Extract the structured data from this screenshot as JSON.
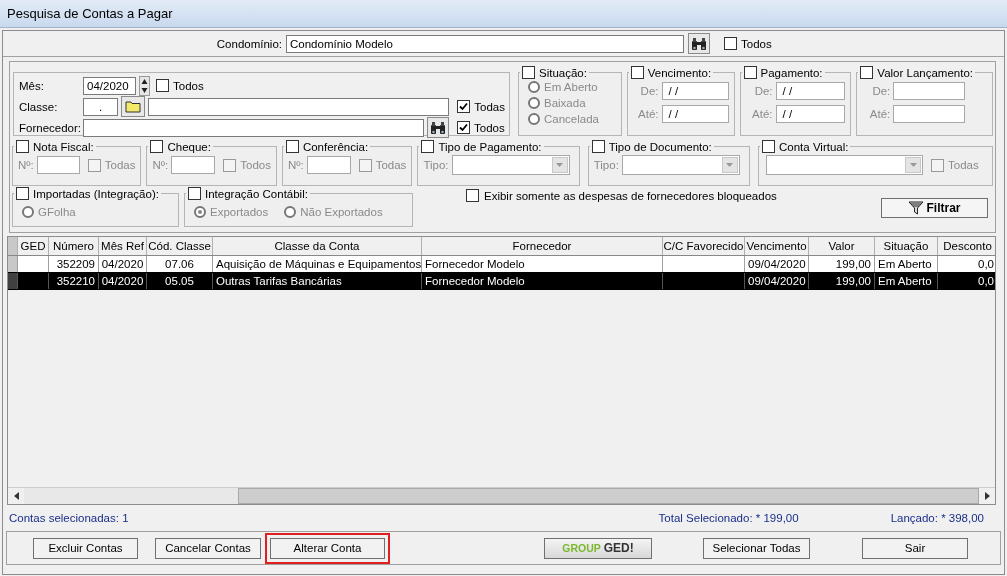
{
  "window": {
    "title": "Pesquisa de Contas a Pagar"
  },
  "condominio": {
    "label": "Condomínio:",
    "value": "Condomínio Modelo",
    "todos": {
      "label": "Todos",
      "checked": false
    }
  },
  "main_filters": {
    "mes": {
      "label": "Mês:",
      "value": "04/2020",
      "todos": {
        "label": "Todos",
        "checked": false
      }
    },
    "classe": {
      "label": "Classe:",
      "code": ".",
      "todas": {
        "label": "Todas",
        "checked": true
      }
    },
    "fornecedor": {
      "label": "Fornecedor:",
      "todos": {
        "label": "Todos",
        "checked": true
      }
    }
  },
  "filter_rows": [
    [
      {
        "kind": "radio_stack",
        "title": "Situação:",
        "checked": false,
        "disabled": true,
        "options": [
          {
            "label": "Em Aberto",
            "selected": false
          },
          {
            "label": "Baixada",
            "selected": false
          },
          {
            "label": "Cancelada",
            "selected": false
          }
        ]
      },
      {
        "kind": "range",
        "title": "Vencimento:",
        "checked": false,
        "disabled": true,
        "fields": [
          {
            "label": "De:",
            "value": "/ /"
          },
          {
            "label": "Até:",
            "value": "/ /"
          }
        ]
      },
      {
        "kind": "range",
        "title": "Pagamento:",
        "checked": false,
        "disabled": true,
        "fields": [
          {
            "label": "De:",
            "value": "/ /"
          },
          {
            "label": "Até:",
            "value": "/ /"
          }
        ]
      },
      {
        "kind": "range",
        "title": "Valor Lançamento:",
        "checked": false,
        "disabled": true,
        "fields": [
          {
            "label": "De:"
          },
          {
            "label": "Até:"
          }
        ]
      }
    ],
    [
      {
        "kind": "number",
        "title": "Nota Fiscal:",
        "checked": false,
        "disabled": true,
        "field_label": "Nº:",
        "option": {
          "label": "Todas",
          "checked": false
        }
      },
      {
        "kind": "number",
        "title": "Cheque:",
        "checked": false,
        "disabled": true,
        "field_label": "Nº:",
        "option": {
          "label": "Todos",
          "checked": false
        }
      },
      {
        "kind": "number",
        "title": "Conferência:",
        "checked": false,
        "disabled": true,
        "field_label": "Nº:",
        "option": {
          "label": "Todas",
          "checked": false
        }
      },
      {
        "kind": "combo",
        "title": "Tipo de Pagamento:",
        "checked": false,
        "disabled": true,
        "field_label": "Tipo:"
      },
      {
        "kind": "combo",
        "title": "Tipo de Documento:",
        "checked": false,
        "disabled": true,
        "field_label": "Tipo:"
      },
      {
        "kind": "combo",
        "title": "Conta Virtual:",
        "checked": false,
        "disabled": true,
        "option": {
          "label": "Todas",
          "checked": false
        }
      }
    ],
    [
      {
        "kind": "radio_row",
        "title": "Importadas (Integração):",
        "checked": false,
        "disabled": true,
        "options": [
          {
            "label": "GFolha",
            "selected": false
          }
        ]
      },
      {
        "kind": "radio_row",
        "title": "Integração Contábil:",
        "checked": false,
        "disabled": true,
        "options": [
          {
            "label": "Exportados",
            "selected": true
          },
          {
            "label": "Não Exportados",
            "selected": false
          }
        ]
      }
    ]
  ],
  "bloqueados": {
    "label": "Exibir somente as despesas de fornecedores bloqueados",
    "checked": false
  },
  "filter_button": {
    "label": "Filtrar"
  },
  "table": {
    "columns": [
      "GED",
      "Número",
      "Mês Ref",
      "Cód. Classe",
      "Classe da Conta",
      "Fornecedor",
      "C/C Favorecido",
      "Vencimento",
      "Valor",
      "Situação",
      "Desconto"
    ],
    "rows": [
      {
        "selected": false,
        "cells": [
          "",
          "352209",
          "04/2020",
          "07.06",
          "Aquisição de Máquinas e Equipamentos",
          "Fornecedor Modelo",
          "",
          "09/04/2020",
          "199,00",
          "Em Aberto",
          "0,0"
        ]
      },
      {
        "selected": true,
        "cells": [
          "",
          "352210",
          "04/2020",
          "05.05",
          "Outras Tarifas Bancárias",
          "Fornecedor Modelo",
          "",
          "09/04/2020",
          "199,00",
          "Em Aberto",
          "0,0"
        ]
      }
    ]
  },
  "status": {
    "selected_count": "Contas selecionadas: 1",
    "total_selected": "Total Selecionado: * 199,00",
    "posted": "Lançado: * 398,00"
  },
  "buttons": [
    {
      "kind": "button",
      "label": "Excluir Contas",
      "highlighted": false
    },
    {
      "kind": "button",
      "label": "Cancelar Contas",
      "highlighted": false
    },
    {
      "kind": "button",
      "label": "Alterar Conta",
      "highlighted": true
    },
    {
      "kind": "logo",
      "label": "GROUP",
      "label_2": "GED!",
      "highlighted": false
    },
    {
      "kind": "button",
      "label": "Selecionar Todas",
      "highlighted": false
    },
    {
      "kind": "button",
      "label": "Sair",
      "highlighted": false
    }
  ]
}
